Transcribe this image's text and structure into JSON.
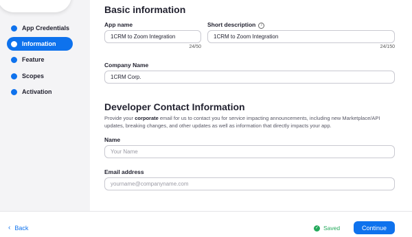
{
  "sidebar": {
    "steps": [
      {
        "label": "App Credentials"
      },
      {
        "label": "Information"
      },
      {
        "label": "Feature"
      },
      {
        "label": "Scopes"
      },
      {
        "label": "Activation"
      }
    ],
    "active": "Information"
  },
  "basic": {
    "title": "Basic information",
    "app_name_label": "App name",
    "app_name_value": "1CRM to Zoom Integration",
    "app_name_counter": "24/50",
    "short_desc_label": "Short description",
    "short_desc_value": "1CRM to Zoom Integration",
    "short_desc_counter": "24/150",
    "company_label": "Company Name",
    "company_value": "1CRM Corp."
  },
  "developer": {
    "title": "Developer Contact Information",
    "desc_before": "Provide your ",
    "desc_bold": "corporate",
    "desc_after": " email for us to contact you for service impacting announcements, including new Marketplace/API updates, breaking changes, and other updates as well as information that directly impacts your app.",
    "name_label": "Name",
    "name_placeholder": "Your Name",
    "email_label": "Email address",
    "email_placeholder": "yourname@companyname.com"
  },
  "footer": {
    "back_label": "Back",
    "saved_label": "Saved",
    "continue_label": "Continue"
  },
  "colors": {
    "accent": "#0e72ed",
    "saved": "#23a95b"
  },
  "icons": {
    "info": "info-icon",
    "back": "chevron-left-icon",
    "saved": "check-circle-icon"
  }
}
